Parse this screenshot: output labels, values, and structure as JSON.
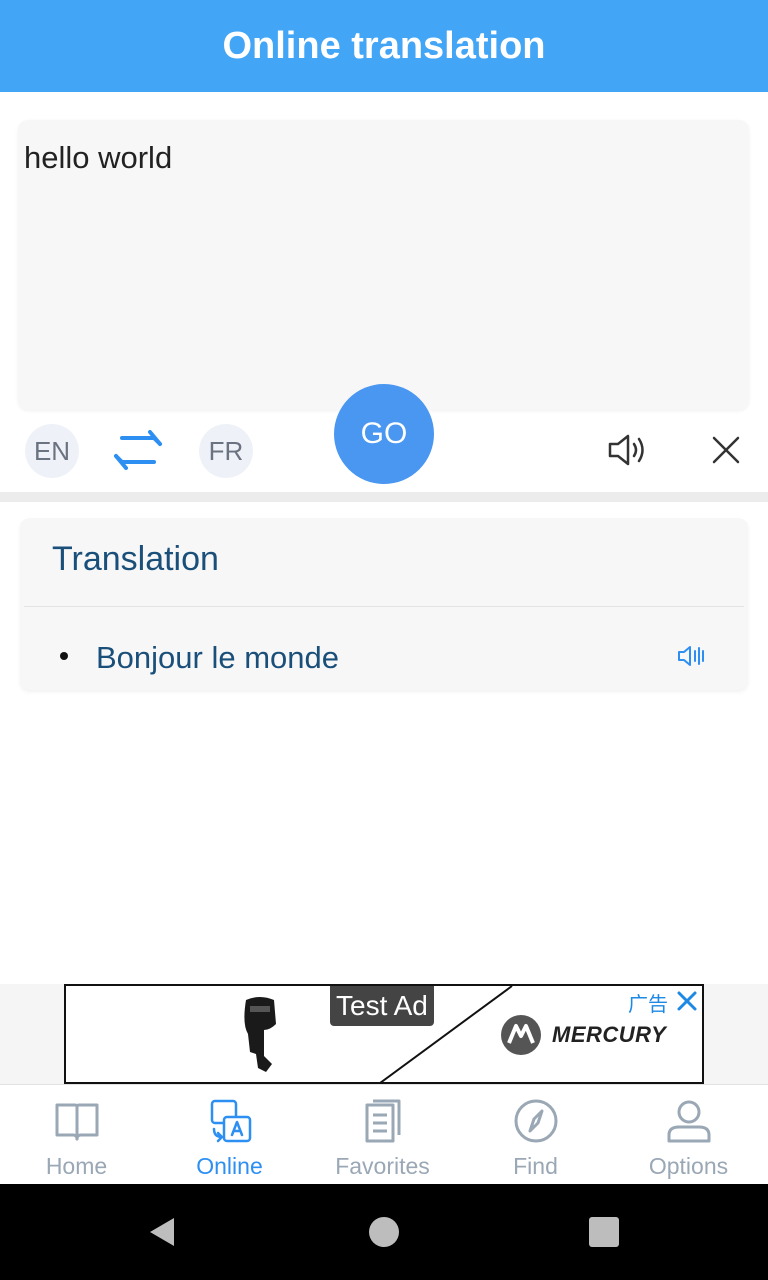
{
  "header": {
    "title": "Online translation"
  },
  "input": {
    "text": "hello world"
  },
  "controls": {
    "source_lang": "EN",
    "target_lang": "FR",
    "go_label": "GO",
    "swap_icon": "swap-arrows-icon",
    "speaker_icon": "speaker-icon",
    "clear_icon": "close-icon"
  },
  "translation": {
    "heading": "Translation",
    "results": [
      "Bonjour le monde"
    ]
  },
  "ad": {
    "label": "Test Ad",
    "cn_label": "广告",
    "brand": "MERCURY"
  },
  "nav": {
    "items": [
      {
        "label": "Home",
        "icon": "book-icon",
        "active": false
      },
      {
        "label": "Online",
        "icon": "translate-icon",
        "active": true
      },
      {
        "label": "Favorites",
        "icon": "document-icon",
        "active": false
      },
      {
        "label": "Find",
        "icon": "compass-icon",
        "active": false
      },
      {
        "label": "Options",
        "icon": "user-icon",
        "active": false
      }
    ]
  },
  "colors": {
    "header_bg": "#42a5f5",
    "go_button": "#4a97f1",
    "active_nav": "#2e8ff3",
    "inactive_nav": "#9aa7b5",
    "translation_text": "#1a4f7a"
  }
}
